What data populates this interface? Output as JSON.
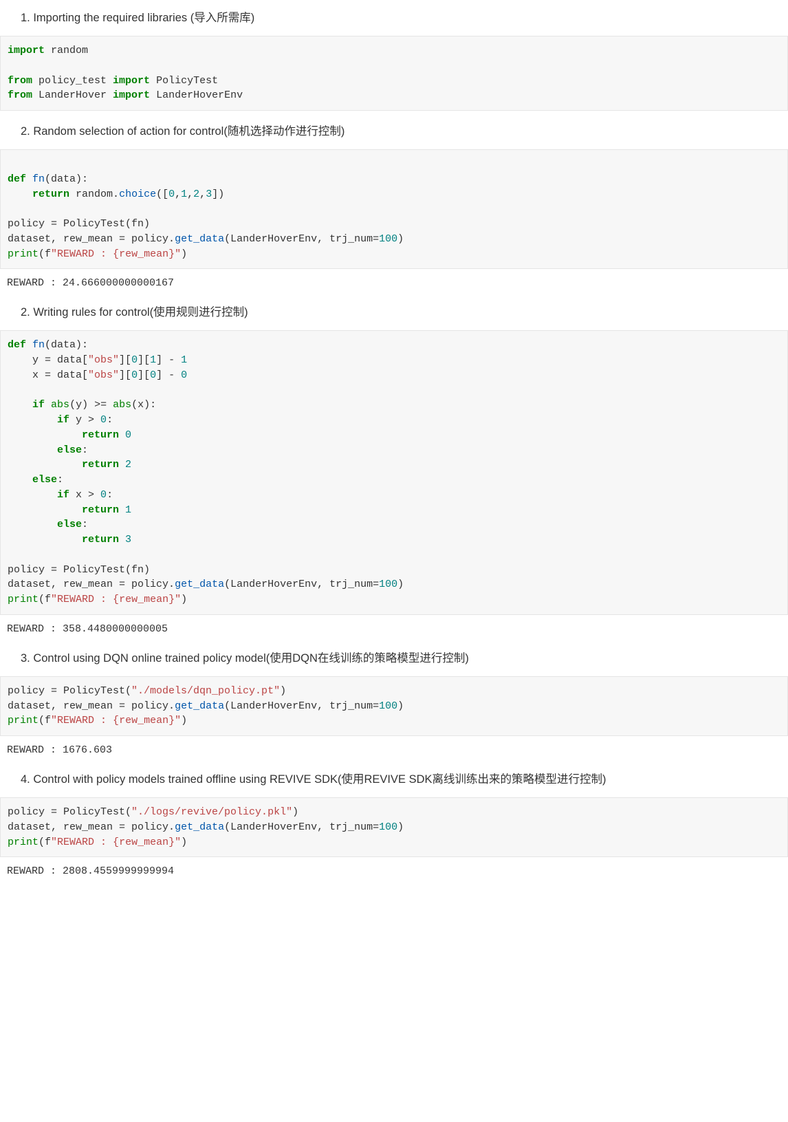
{
  "sections": {
    "s1_heading": "1. Importing the required libraries (导入所需库)",
    "s2_heading": "2. Random selection of action for control(随机选择动作进行控制)",
    "s3_heading": "2. Writing rules for control(使用规则进行控制)",
    "s4_heading": "3. Control using DQN online trained policy model(使用DQN在线训练的策略模型进行控制)",
    "s5_heading": "4. Control with policy models trained offline using REVIVE SDK(使用REVIVE SDK离线训练出来的策略模型进行控制)"
  },
  "code1": {
    "l1_kw1": "import",
    "l1_mod": " random",
    "l2_kw1": "from",
    "l2_mod": " policy_test ",
    "l2_kw2": "import",
    "l2_cls": " PolicyTest",
    "l3_kw1": "from",
    "l3_mod": " LanderHover ",
    "l3_kw2": "import",
    "l3_cls": " LanderHoverEnv"
  },
  "code2": {
    "l1_kw": "def",
    "l1_name": " fn",
    "l1_rest": "(data):",
    "l2_kw": "return",
    "l2_a": " random",
    "l2_dot": ".",
    "l2_fn": "choice",
    "l2_open": "([",
    "l2_n0": "0",
    "l2_c1": ",",
    "l2_n1": "1",
    "l2_c2": ",",
    "l2_n2": "2",
    "l2_c3": ",",
    "l2_n3": "3",
    "l2_close": "])",
    "l4": "policy = PolicyTest(fn)",
    "l5_a": "dataset, rew_mean = policy",
    "l5_dot": ".",
    "l5_fn": "get_data",
    "l5_b": "(LanderHoverEnv, trj_num=",
    "l5_n": "100",
    "l5_c": ")",
    "l6_fn": "print",
    "l6_a": "(",
    "l6_pref": "f",
    "l6_str": "\"REWARD : {rew_mean}\"",
    "l6_b": ")"
  },
  "out2": "REWARD : 24.666000000000167",
  "code3": {
    "l1_kw": "def",
    "l1_name": " fn",
    "l1_rest": "(data):",
    "l2_a": "    y = data[",
    "l2_s": "\"obs\"",
    "l2_b": "][",
    "l2_n0": "0",
    "l2_c": "][",
    "l2_n1": "1",
    "l2_d": "] - ",
    "l2_n2": "1",
    "l3_a": "    x = data[",
    "l3_s": "\"obs\"",
    "l3_b": "][",
    "l3_n0": "0",
    "l3_c": "][",
    "l3_n1": "0",
    "l3_d": "] - ",
    "l3_n2": "0",
    "l5_kw": "if",
    "l5_a": " ",
    "l5_abs1": "abs",
    "l5_b": "(y) >= ",
    "l5_abs2": "abs",
    "l5_c": "(x):",
    "l6_kw": "if",
    "l6_a": " y > ",
    "l6_n": "0",
    "l6_b": ":",
    "l7_kw": "return",
    "l7_n": " 0",
    "l8_kw": "else",
    "l8_b": ":",
    "l9_kw": "return",
    "l9_n": " 2",
    "l10_kw": "else",
    "l10_b": ":",
    "l11_kw": "if",
    "l11_a": " x > ",
    "l11_n": "0",
    "l11_b": ":",
    "l12_kw": "return",
    "l12_n": " 1",
    "l13_kw": "else",
    "l13_b": ":",
    "l14_kw": "return",
    "l14_n": " 3",
    "l16": "policy = PolicyTest(fn)",
    "l17_a": "dataset, rew_mean = policy",
    "l17_dot": ".",
    "l17_fn": "get_data",
    "l17_b": "(LanderHoverEnv, trj_num=",
    "l17_n": "100",
    "l17_c": ")",
    "l18_fn": "print",
    "l18_a": "(",
    "l18_pref": "f",
    "l18_str": "\"REWARD : {rew_mean}\"",
    "l18_b": ")"
  },
  "out3": "REWARD : 358.4480000000005",
  "code4": {
    "l1_a": "policy = PolicyTest(",
    "l1_s": "\"./models/dqn_policy.pt\"",
    "l1_b": ")",
    "l2_a": "dataset, rew_mean = policy",
    "l2_dot": ".",
    "l2_fn": "get_data",
    "l2_b": "(LanderHoverEnv, trj_num=",
    "l2_n": "100",
    "l2_c": ")",
    "l3_fn": "print",
    "l3_a": "(",
    "l3_pref": "f",
    "l3_str": "\"REWARD : {rew_mean}\"",
    "l3_b": ")"
  },
  "out4": "REWARD : 1676.603",
  "code5": {
    "l1_a": "policy = PolicyTest(",
    "l1_s": "\"./logs/revive/policy.pkl\"",
    "l1_b": ")",
    "l2_a": "dataset, rew_mean = policy",
    "l2_dot": ".",
    "l2_fn": "get_data",
    "l2_b": "(LanderHoverEnv, trj_num=",
    "l2_n": "100",
    "l2_c": ")",
    "l3_fn": "print",
    "l3_a": "(",
    "l3_pref": "f",
    "l3_str": "\"REWARD : {rew_mean}\"",
    "l3_b": ")"
  },
  "out5": "REWARD : 2808.4559999999994"
}
